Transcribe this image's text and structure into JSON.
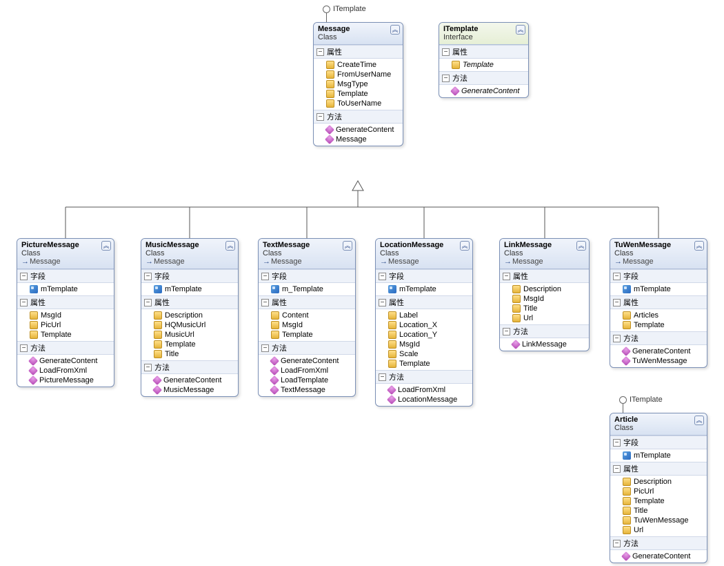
{
  "interface_label": "ITemplate",
  "section_labels": {
    "fields": "字段",
    "properties": "属性",
    "methods": "方法"
  },
  "boxes": {
    "message": {
      "name": "Message",
      "kind": "Class",
      "properties": [
        "CreateTime",
        "FromUserName",
        "MsgType",
        "Template",
        "ToUserName"
      ],
      "methods": [
        "GenerateContent",
        "Message"
      ]
    },
    "itemplate": {
      "name": "ITemplate",
      "kind": "Interface",
      "properties": [
        "Template"
      ],
      "methods": [
        "GenerateContent"
      ]
    },
    "picture": {
      "name": "PictureMessage",
      "kind": "Class",
      "parent": "Message",
      "fields": [
        "mTemplate"
      ],
      "properties": [
        "MsgId",
        "PicUrl",
        "Template"
      ],
      "methods": [
        "GenerateContent",
        "LoadFromXml",
        "PictureMessage"
      ]
    },
    "music": {
      "name": "MusicMessage",
      "kind": "Class",
      "parent": "Message",
      "fields": [
        "mTemplate"
      ],
      "properties": [
        "Description",
        "HQMusicUrl",
        "MusicUrl",
        "Template",
        "Title"
      ],
      "methods": [
        "GenerateContent",
        "MusicMessage"
      ]
    },
    "text": {
      "name": "TextMessage",
      "kind": "Class",
      "parent": "Message",
      "fields": [
        "m_Template"
      ],
      "properties": [
        "Content",
        "MsgId",
        "Template"
      ],
      "methods": [
        "GenerateContent",
        "LoadFromXml",
        "LoadTemplate",
        "TextMessage"
      ]
    },
    "location": {
      "name": "LocationMessage",
      "kind": "Class",
      "parent": "Message",
      "fields": [
        "mTemplate"
      ],
      "properties": [
        "Label",
        "Location_X",
        "Location_Y",
        "MsgId",
        "Scale",
        "Template"
      ],
      "methods": [
        "LoadFromXml",
        "LocationMessage"
      ]
    },
    "link": {
      "name": "LinkMessage",
      "kind": "Class",
      "parent": "Message",
      "properties": [
        "Description",
        "MsgId",
        "Title",
        "Url"
      ],
      "methods": [
        "LinkMessage"
      ]
    },
    "tuwen": {
      "name": "TuWenMessage",
      "kind": "Class",
      "parent": "Message",
      "fields": [
        "mTemplate"
      ],
      "properties": [
        "Articles",
        "Template"
      ],
      "methods": [
        "GenerateContent",
        "TuWenMessage"
      ]
    },
    "article": {
      "name": "Article",
      "kind": "Class",
      "fields": [
        "mTemplate"
      ],
      "properties": [
        "Description",
        "PicUrl",
        "Template",
        "Title",
        "TuWenMessage",
        "Url"
      ],
      "methods": [
        "GenerateContent"
      ]
    }
  }
}
